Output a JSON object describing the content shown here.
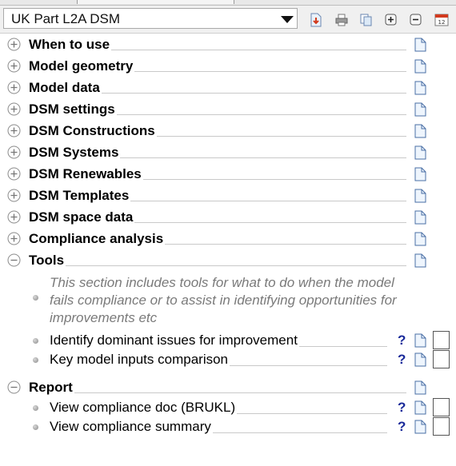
{
  "toolbar": {
    "selector_value": "UK Part L2A DSM",
    "icons": [
      "export-icon",
      "print-icon",
      "copy-icon",
      "expand-all-icon",
      "collapse-all-icon",
      "calendar-icon"
    ],
    "calendar_label": "12"
  },
  "sections": [
    {
      "label": "When to use",
      "expanded": false
    },
    {
      "label": "Model geometry",
      "expanded": false
    },
    {
      "label": "Model data",
      "expanded": false
    },
    {
      "label": "DSM settings",
      "expanded": false
    },
    {
      "label": "DSM Constructions",
      "expanded": false
    },
    {
      "label": "DSM Systems",
      "expanded": false
    },
    {
      "label": "DSM Renewables",
      "expanded": false
    },
    {
      "label": "DSM Templates",
      "expanded": false
    },
    {
      "label": "DSM space data",
      "expanded": false
    },
    {
      "label": "Compliance analysis",
      "expanded": false
    },
    {
      "label": "Tools",
      "expanded": true
    },
    {
      "label": "Report",
      "expanded": true
    }
  ],
  "tools": {
    "note": "This section includes tools for what to do when the model fails compliance or to assist in identifying opportunities for improvements etc",
    "items": [
      {
        "label": "Identify dominant issues for improvement",
        "help": "?"
      },
      {
        "label": "Key model inputs comparison",
        "help": "?"
      }
    ]
  },
  "report": {
    "items": [
      {
        "label": "View compliance doc (BRUKL)",
        "help": "?"
      },
      {
        "label": "View compliance summary",
        "help": "?"
      }
    ]
  }
}
